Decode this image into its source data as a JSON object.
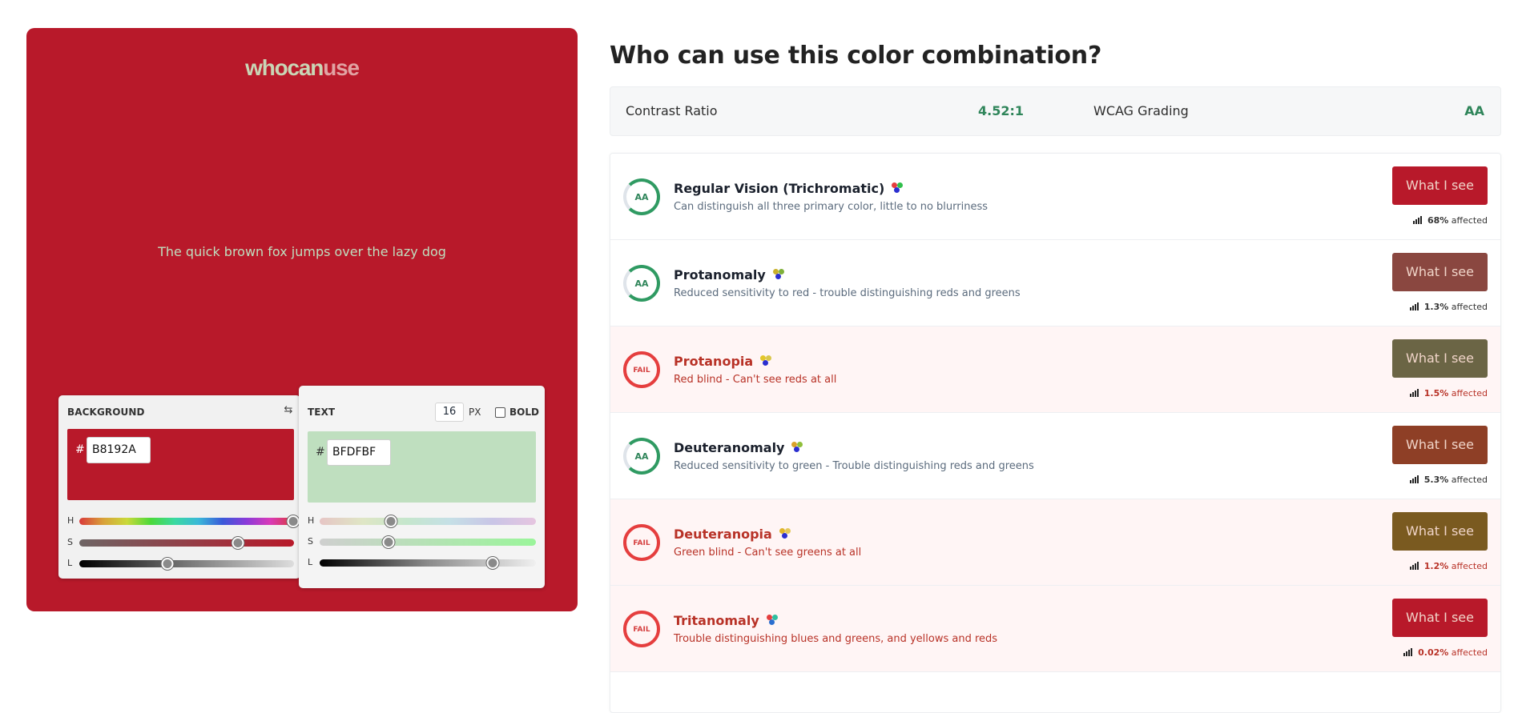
{
  "logo": {
    "part1": "whocan",
    "part2": "use"
  },
  "sample_text": "The quick brown fox jumps over the lazy dog",
  "colors": {
    "background": "#B8192A",
    "text": "#BFDFBF",
    "pass": "#2f855a",
    "fail": "#e53e3e"
  },
  "background_card": {
    "label": "BACKGROUND",
    "hash": "#",
    "hex": "B8192A",
    "sliders": [
      {
        "letter": "H",
        "value": 0.995
      },
      {
        "letter": "S",
        "value": 0.74
      },
      {
        "letter": "L",
        "value": 0.41
      }
    ]
  },
  "text_card": {
    "label": "TEXT",
    "size": "16",
    "size_unit": "PX",
    "bold_label": "BOLD",
    "hash": "#",
    "hex": "BFDFBF",
    "sliders": [
      {
        "letter": "H",
        "value": 0.33
      },
      {
        "letter": "S",
        "value": 0.32
      },
      {
        "letter": "L",
        "value": 0.8
      }
    ]
  },
  "page_title": "Who can use this color combination?",
  "summary": {
    "contrast_label": "Contrast Ratio",
    "contrast_value": "4.52:1",
    "wcag_label": "WCAG Grading",
    "wcag_value": "AA"
  },
  "rows": [
    {
      "grade": "AA",
      "status": "pass",
      "title": "Regular Vision (Trichromatic)",
      "desc": "Can distinguish all three primary color, little to no blurriness",
      "button": "What I see",
      "button_color": "#B8192A",
      "affected_pct": "68%",
      "affected_label": "affected",
      "dots": [
        "#e53e3e",
        "#2fbf4a",
        "#2b2fd0"
      ]
    },
    {
      "grade": "AA",
      "status": "pass",
      "title": "Protanomaly",
      "desc": "Reduced sensitivity to red - trouble distinguishing reds and greens",
      "button": "What I see",
      "button_color": "#8a4740",
      "affected_pct": "1.3%",
      "affected_label": "affected",
      "dots": [
        "#c9b02a",
        "#7fb03a",
        "#2b2fd0"
      ]
    },
    {
      "grade": "FAIL",
      "status": "fail",
      "title": "Protanopia",
      "desc": "Red blind - Can't see reds at all",
      "button": "What I see",
      "button_color": "#6b6545",
      "affected_pct": "1.5%",
      "affected_label": "affected",
      "dots": [
        "#e3c62a",
        "#d9c74a",
        "#2b2fd0"
      ]
    },
    {
      "grade": "AA",
      "status": "pass",
      "title": "Deuteranomaly",
      "desc": "Reduced sensitivity to green - Trouble distinguishing reds and greens",
      "button": "What I see",
      "button_color": "#8e3f26",
      "affected_pct": "5.3%",
      "affected_label": "affected",
      "dots": [
        "#d9a32a",
        "#8fbf3a",
        "#2b2fd0"
      ]
    },
    {
      "grade": "FAIL",
      "status": "fail",
      "title": "Deuteranopia",
      "desc": "Green blind - Can't see greens at all",
      "button": "What I see",
      "button_color": "#7a5a20",
      "affected_pct": "1.2%",
      "affected_label": "affected",
      "dots": [
        "#e0b52a",
        "#e3c85a",
        "#2b2fd0"
      ]
    },
    {
      "grade": "FAIL",
      "status": "fail",
      "title": "Tritanomaly",
      "desc": "Trouble distinguishing blues and greens, and yellows and reds",
      "button": "What I see",
      "button_color": "#B8192A",
      "affected_pct": "0.02%",
      "affected_label": "affected",
      "dots": [
        "#e53e3e",
        "#2fbfa0",
        "#2b6fd0"
      ]
    }
  ]
}
